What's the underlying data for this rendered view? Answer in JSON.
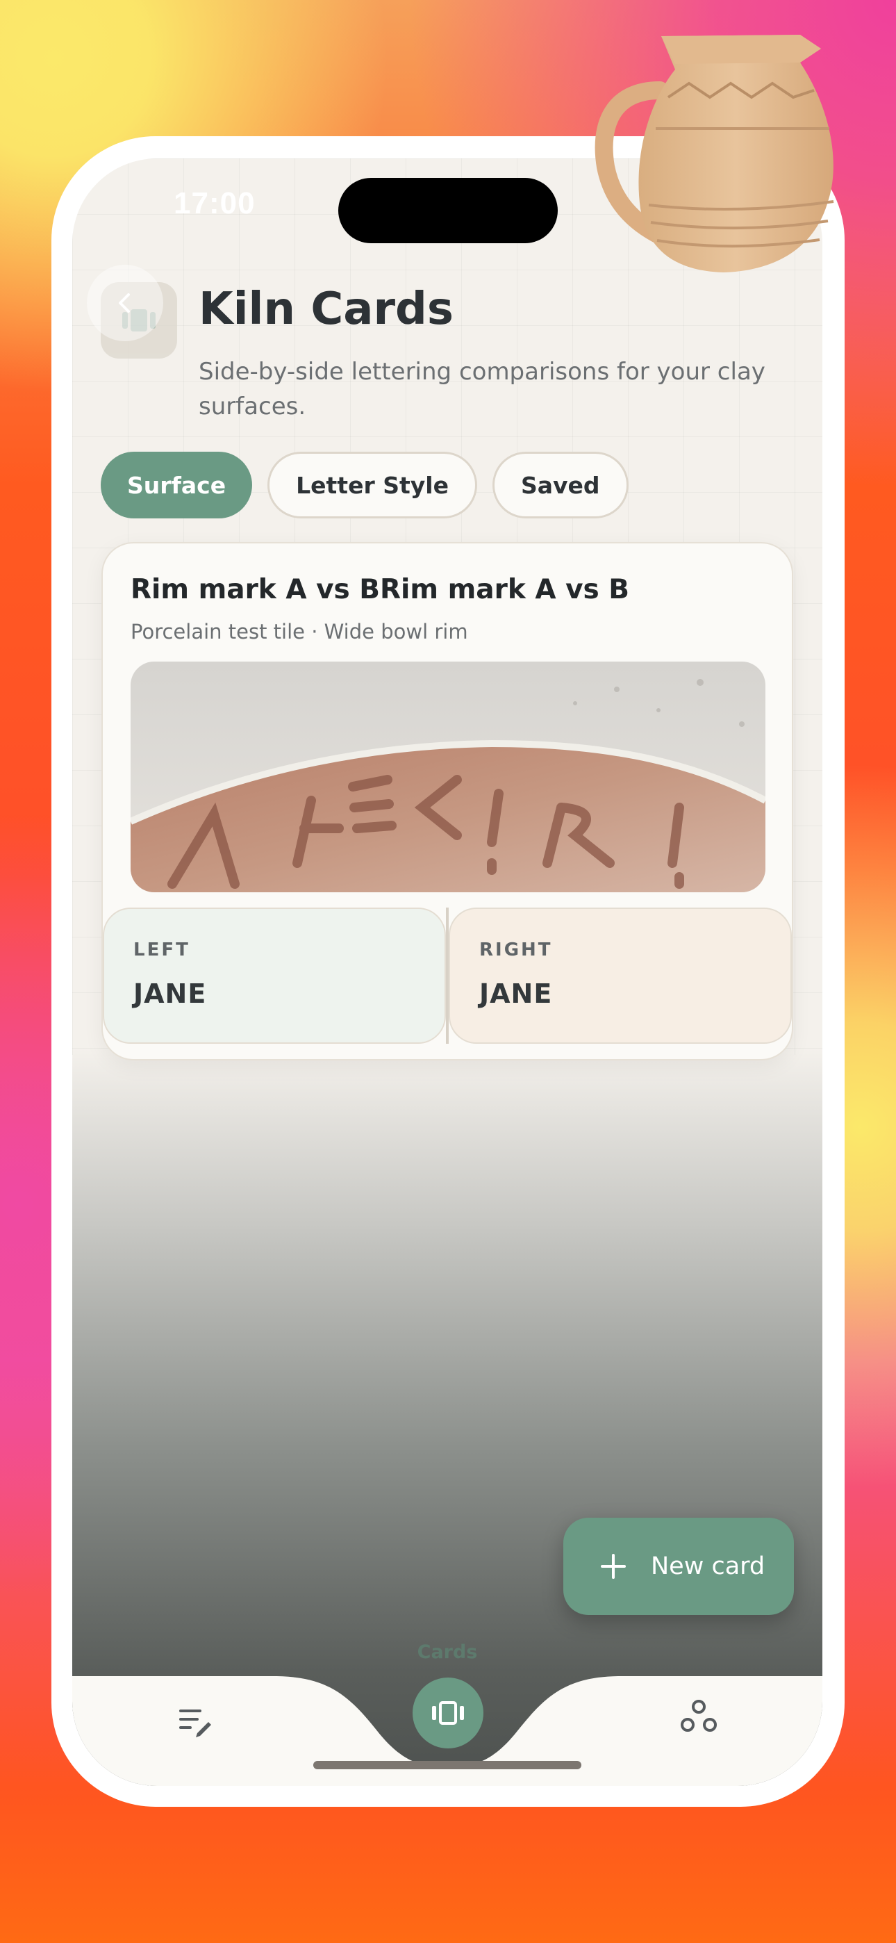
{
  "status_bar": {
    "time": "17:00"
  },
  "header": {
    "title": "Kiln Cards",
    "subtitle": "Side-by-side lettering comparisons for your clay surfaces."
  },
  "filters": [
    {
      "label": "Surface",
      "active": true
    },
    {
      "label": "Letter Style",
      "active": false
    },
    {
      "label": "Saved",
      "active": false
    }
  ],
  "card": {
    "title": "Rim mark A vs BRim mark A vs B",
    "subtitle": "Porcelain test tile · Wide bowl rim",
    "image_icon": "clay-rim-lettering-photo",
    "left": {
      "label": "LEFT",
      "value": "JANE"
    },
    "right": {
      "label": "RIGHT",
      "value": "JANE"
    }
  },
  "fab": {
    "label": "New card",
    "icon": "plus-icon"
  },
  "tabbar": {
    "active_label": "Cards",
    "items": [
      {
        "icon": "edit-list-icon"
      },
      {
        "icon": "cards-carousel-icon"
      },
      {
        "icon": "circles-share-icon"
      }
    ]
  },
  "colors": {
    "accent": "#6a9a84",
    "surface": "#fbfaf7",
    "left_tint": "#eef3ee",
    "right_tint": "#f7eee4",
    "text_primary": "#2d3236"
  }
}
